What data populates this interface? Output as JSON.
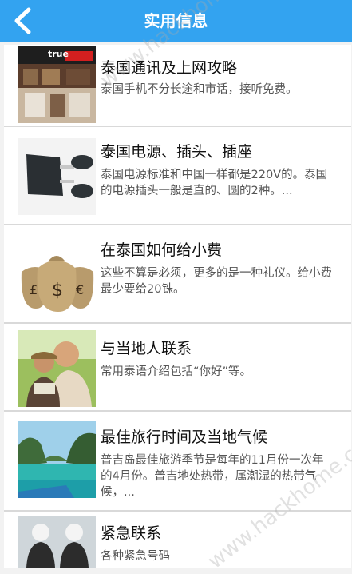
{
  "header": {
    "title": "实用信息"
  },
  "items": [
    {
      "title": "泰国通讯及上网攻略",
      "desc": "泰国手机不分长途和市话，接听免费。",
      "thumb": "store-photo",
      "thumb_text": "true"
    },
    {
      "title": "泰国电源、插头、插座",
      "desc": "泰国电源标准和中国一样都是220V的。泰国的电源插头一般是直的、圆的2种。...",
      "thumb": "power-plugs-photo"
    },
    {
      "title": "在泰国如何给小费",
      "desc": "这些不算是必须，更多的是一种礼仪。给小费最少要给20铢。",
      "thumb": "money-bags-photo"
    },
    {
      "title": "与当地人联系",
      "desc": "常用泰语介绍包括“你好”等。",
      "thumb": "travelers-photo"
    },
    {
      "title": "最佳旅行时间及当地气候",
      "desc": "普吉岛最佳旅游季节是每年的11月份一次年的4月份。普吉地处热带，属潮湿的热带气候，...",
      "thumb": "bay-photo"
    },
    {
      "title": "紧急联系",
      "desc": "各种紧急号码",
      "thumb": "police-photo"
    }
  ],
  "watermark": "www.hackhome.com"
}
